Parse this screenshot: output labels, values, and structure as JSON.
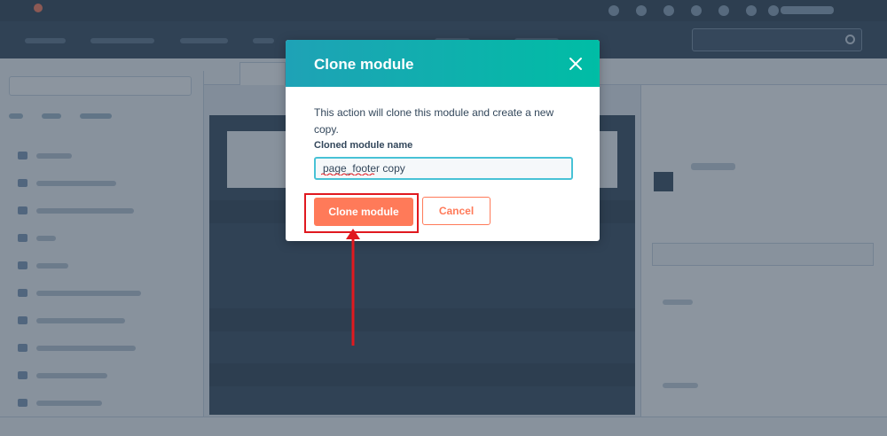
{
  "modal": {
    "title": "Clone module",
    "description": "This action will clone this module and create a new copy.",
    "field_label": "Cloned module name",
    "input_value": "page_footer copy",
    "primary_button": "Clone module",
    "secondary_button": "Cancel"
  },
  "colors": {
    "header_gradient_start": "#1fa2b6",
    "header_gradient_end": "#00bda5",
    "primary": "#ff7a59",
    "input_focus_border": "#48c2d6",
    "annotation": "#e0191f",
    "overlay": "#2d3e50"
  },
  "icons": {
    "close": "close-icon",
    "arrow": "arrow-up-icon"
  }
}
